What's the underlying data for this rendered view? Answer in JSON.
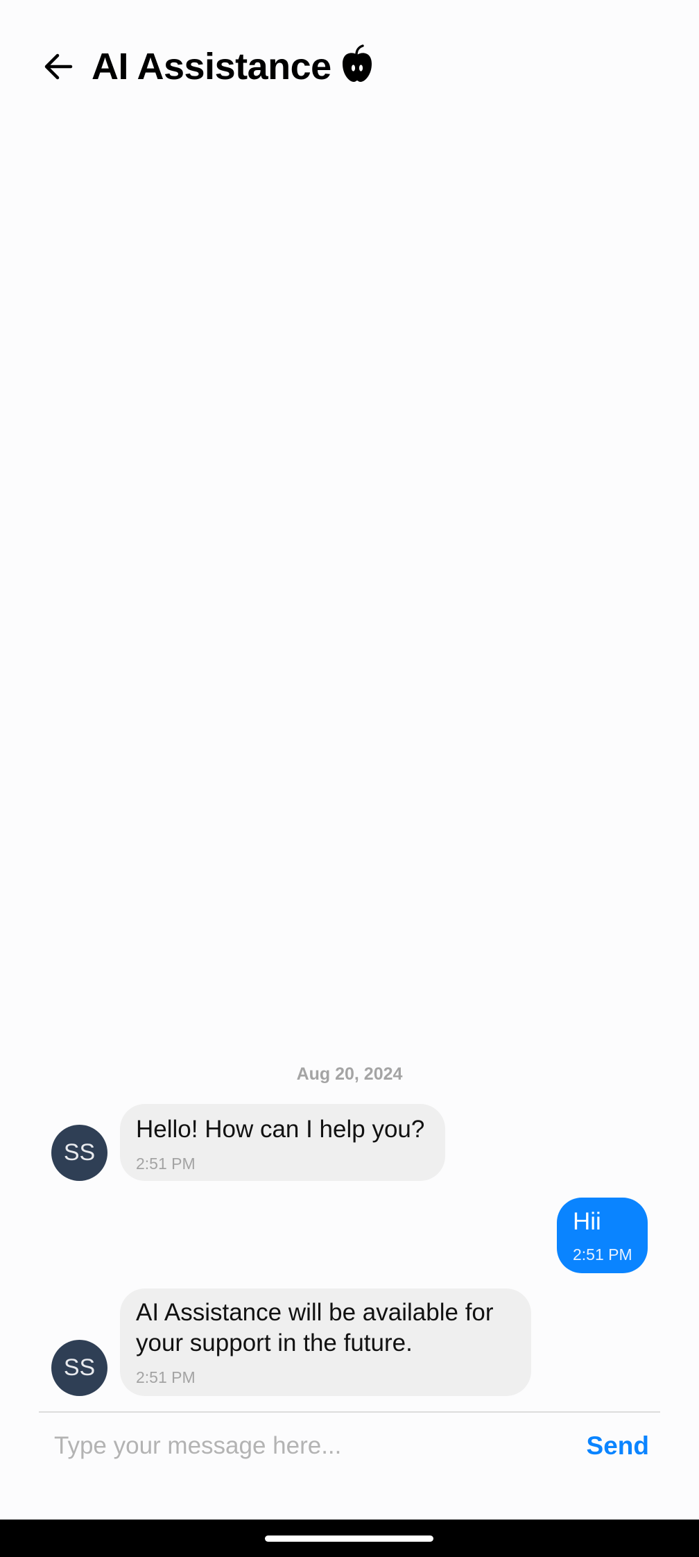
{
  "header": {
    "title": "AI Assistance",
    "back_icon": "arrow-left-icon",
    "title_icon": "apple-icon"
  },
  "conversation": {
    "date_separator": "Aug 20, 2024",
    "messages": [
      {
        "direction": "incoming",
        "avatar_initials": "SS",
        "text": "Hello! How can I help you?",
        "time": "2:51 PM"
      },
      {
        "direction": "outgoing",
        "text": "Hii",
        "time": "2:51 PM"
      },
      {
        "direction": "incoming",
        "avatar_initials": "SS",
        "text_lines": [
          "AI Assistance will be available for",
          "your support in the future."
        ],
        "time": "2:51 PM"
      }
    ]
  },
  "composer": {
    "placeholder": "Type your message here...",
    "value": "",
    "send_label": "Send"
  },
  "colors": {
    "accent": "#0a84ff",
    "incoming_bubble": "#efefef",
    "avatar_bg": "#2f3f55",
    "background": "#fcfcfd"
  }
}
